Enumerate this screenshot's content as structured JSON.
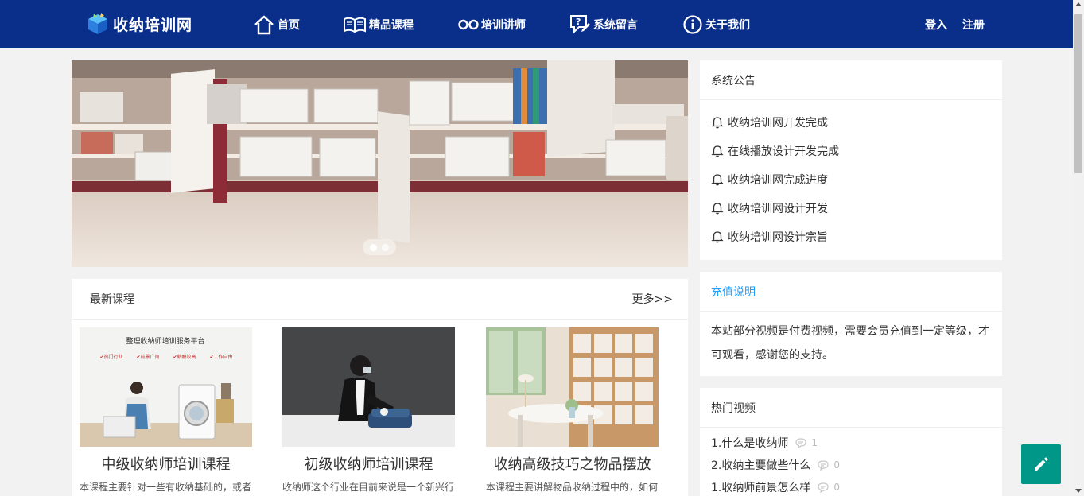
{
  "header": {
    "logo_text": "收纳培训网",
    "nav": [
      {
        "label": "首页",
        "icon": "home-icon"
      },
      {
        "label": "精品课程",
        "icon": "book-icon"
      },
      {
        "label": "培训讲师",
        "icon": "glasses-icon"
      },
      {
        "label": "系统留言",
        "icon": "message-icon"
      },
      {
        "label": "关于我们",
        "icon": "info-icon"
      }
    ],
    "login_label": "登入",
    "register_label": "注册"
  },
  "banner": {
    "slide_count": 2,
    "active_slide": 1
  },
  "courses": {
    "title": "最新课程",
    "more_label": "更多>>",
    "items": [
      {
        "name": "中级收纳师培训课程",
        "desc": "本课程主要针对一些有收纳基础的，或者",
        "thumb_title": "整理收纳师培训服务平台",
        "thumb_tags": [
          "✔热门行业",
          "✔前景广阔",
          "✔薪酬较高",
          "✔工作自由"
        ]
      },
      {
        "name": "初级收纳师培训课程",
        "desc": "收纳师这个行业在目前来说是一个新兴行"
      },
      {
        "name": "收纳高级技巧之物品摆放",
        "desc": "本课程主要讲解物品收纳过程中的，如何"
      }
    ]
  },
  "notice": {
    "title": "系统公告",
    "items": [
      "收纳培训网开发完成",
      "在线播放设计开发完成",
      "收纳培训网完成进度",
      "收纳培训网设计开发",
      "收纳培训网设计宗旨"
    ]
  },
  "recharge": {
    "title": "充值说明",
    "body": "本站部分视频是付费视频，需要会员充值到一定等级，才可观看，感谢您的支持。"
  },
  "hot_videos": {
    "title": "热门视频",
    "items": [
      {
        "label": "1.什么是收纳师",
        "count": "1"
      },
      {
        "label": "2.收纳主要做些什么",
        "count": "0"
      },
      {
        "label": "1.收纳师前景怎么样",
        "count": "0"
      }
    ]
  },
  "colors": {
    "header_bg": "#0a2f8a",
    "recharge_title": "#1e9fff",
    "fab_bg": "#009688"
  }
}
